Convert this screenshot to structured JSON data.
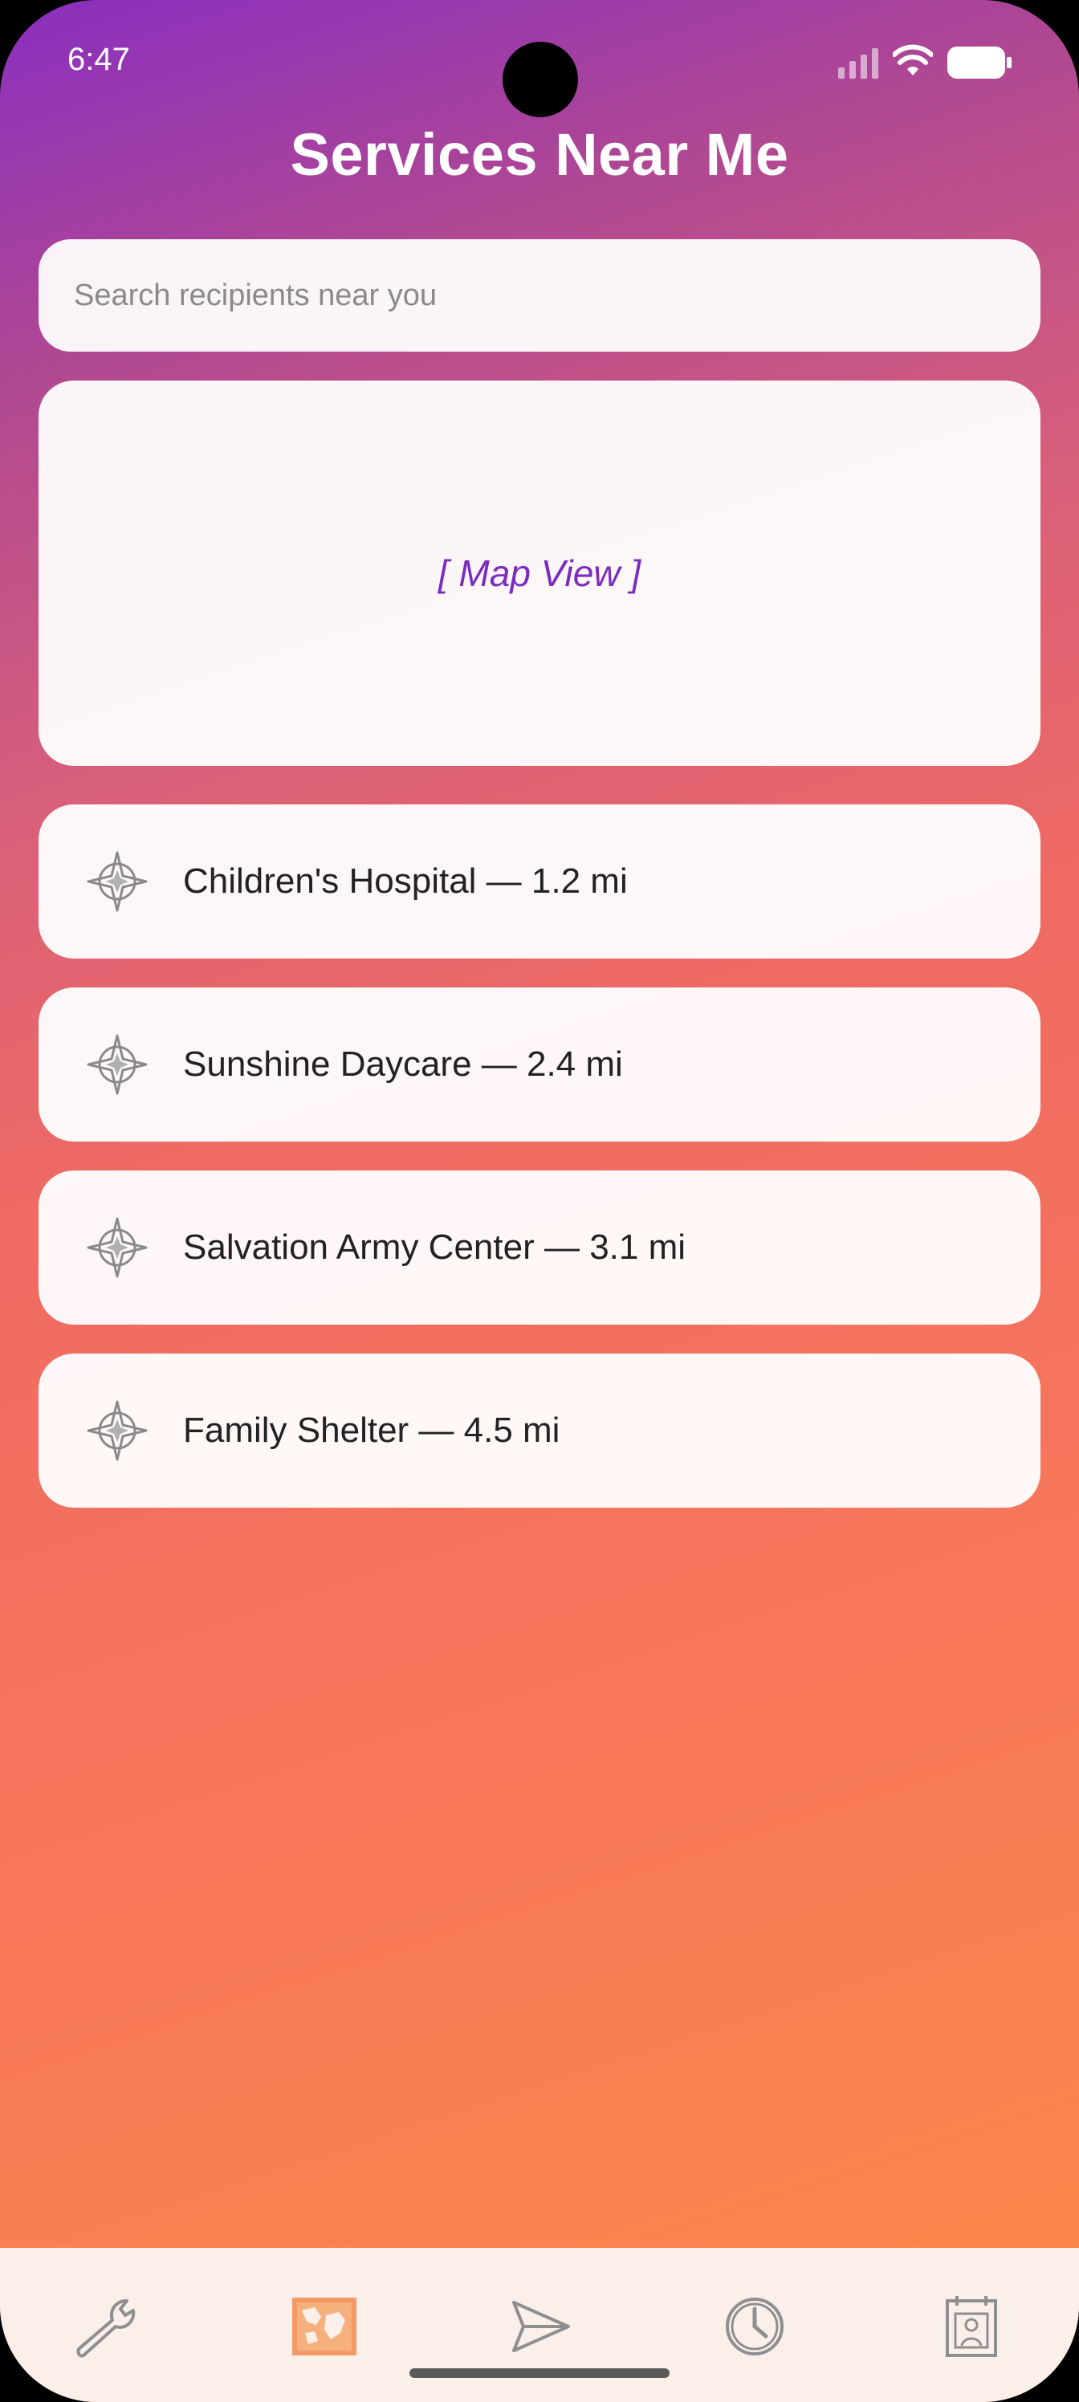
{
  "status_bar": {
    "time": "6:47"
  },
  "header": {
    "title": "Services Near Me"
  },
  "search": {
    "placeholder": "Search recipients near you",
    "value": ""
  },
  "map": {
    "label": "[ Map View ]"
  },
  "recipients": [
    {
      "label": "Children's Hospital — 1.2 mi",
      "icon": "compass-rose-icon"
    },
    {
      "label": "Sunshine Daycare — 2.4 mi",
      "icon": "compass-rose-icon"
    },
    {
      "label": "Salvation Army Center — 3.1 mi",
      "icon": "compass-rose-icon"
    },
    {
      "label": "Family Shelter — 4.5 mi",
      "icon": "compass-rose-icon"
    }
  ],
  "tab_bar": {
    "tabs": [
      {
        "icon": "wrench-icon",
        "active": false
      },
      {
        "icon": "map-icon",
        "active": true
      },
      {
        "icon": "send-icon",
        "active": false
      },
      {
        "icon": "clock-icon",
        "active": false
      },
      {
        "icon": "contact-calendar-icon",
        "active": false
      }
    ]
  },
  "colors": {
    "accent": "#7b2cbf",
    "active_tab": "#f28a4e",
    "gradient_top": "#8a2fc0",
    "gradient_bottom": "#fb8a46"
  }
}
